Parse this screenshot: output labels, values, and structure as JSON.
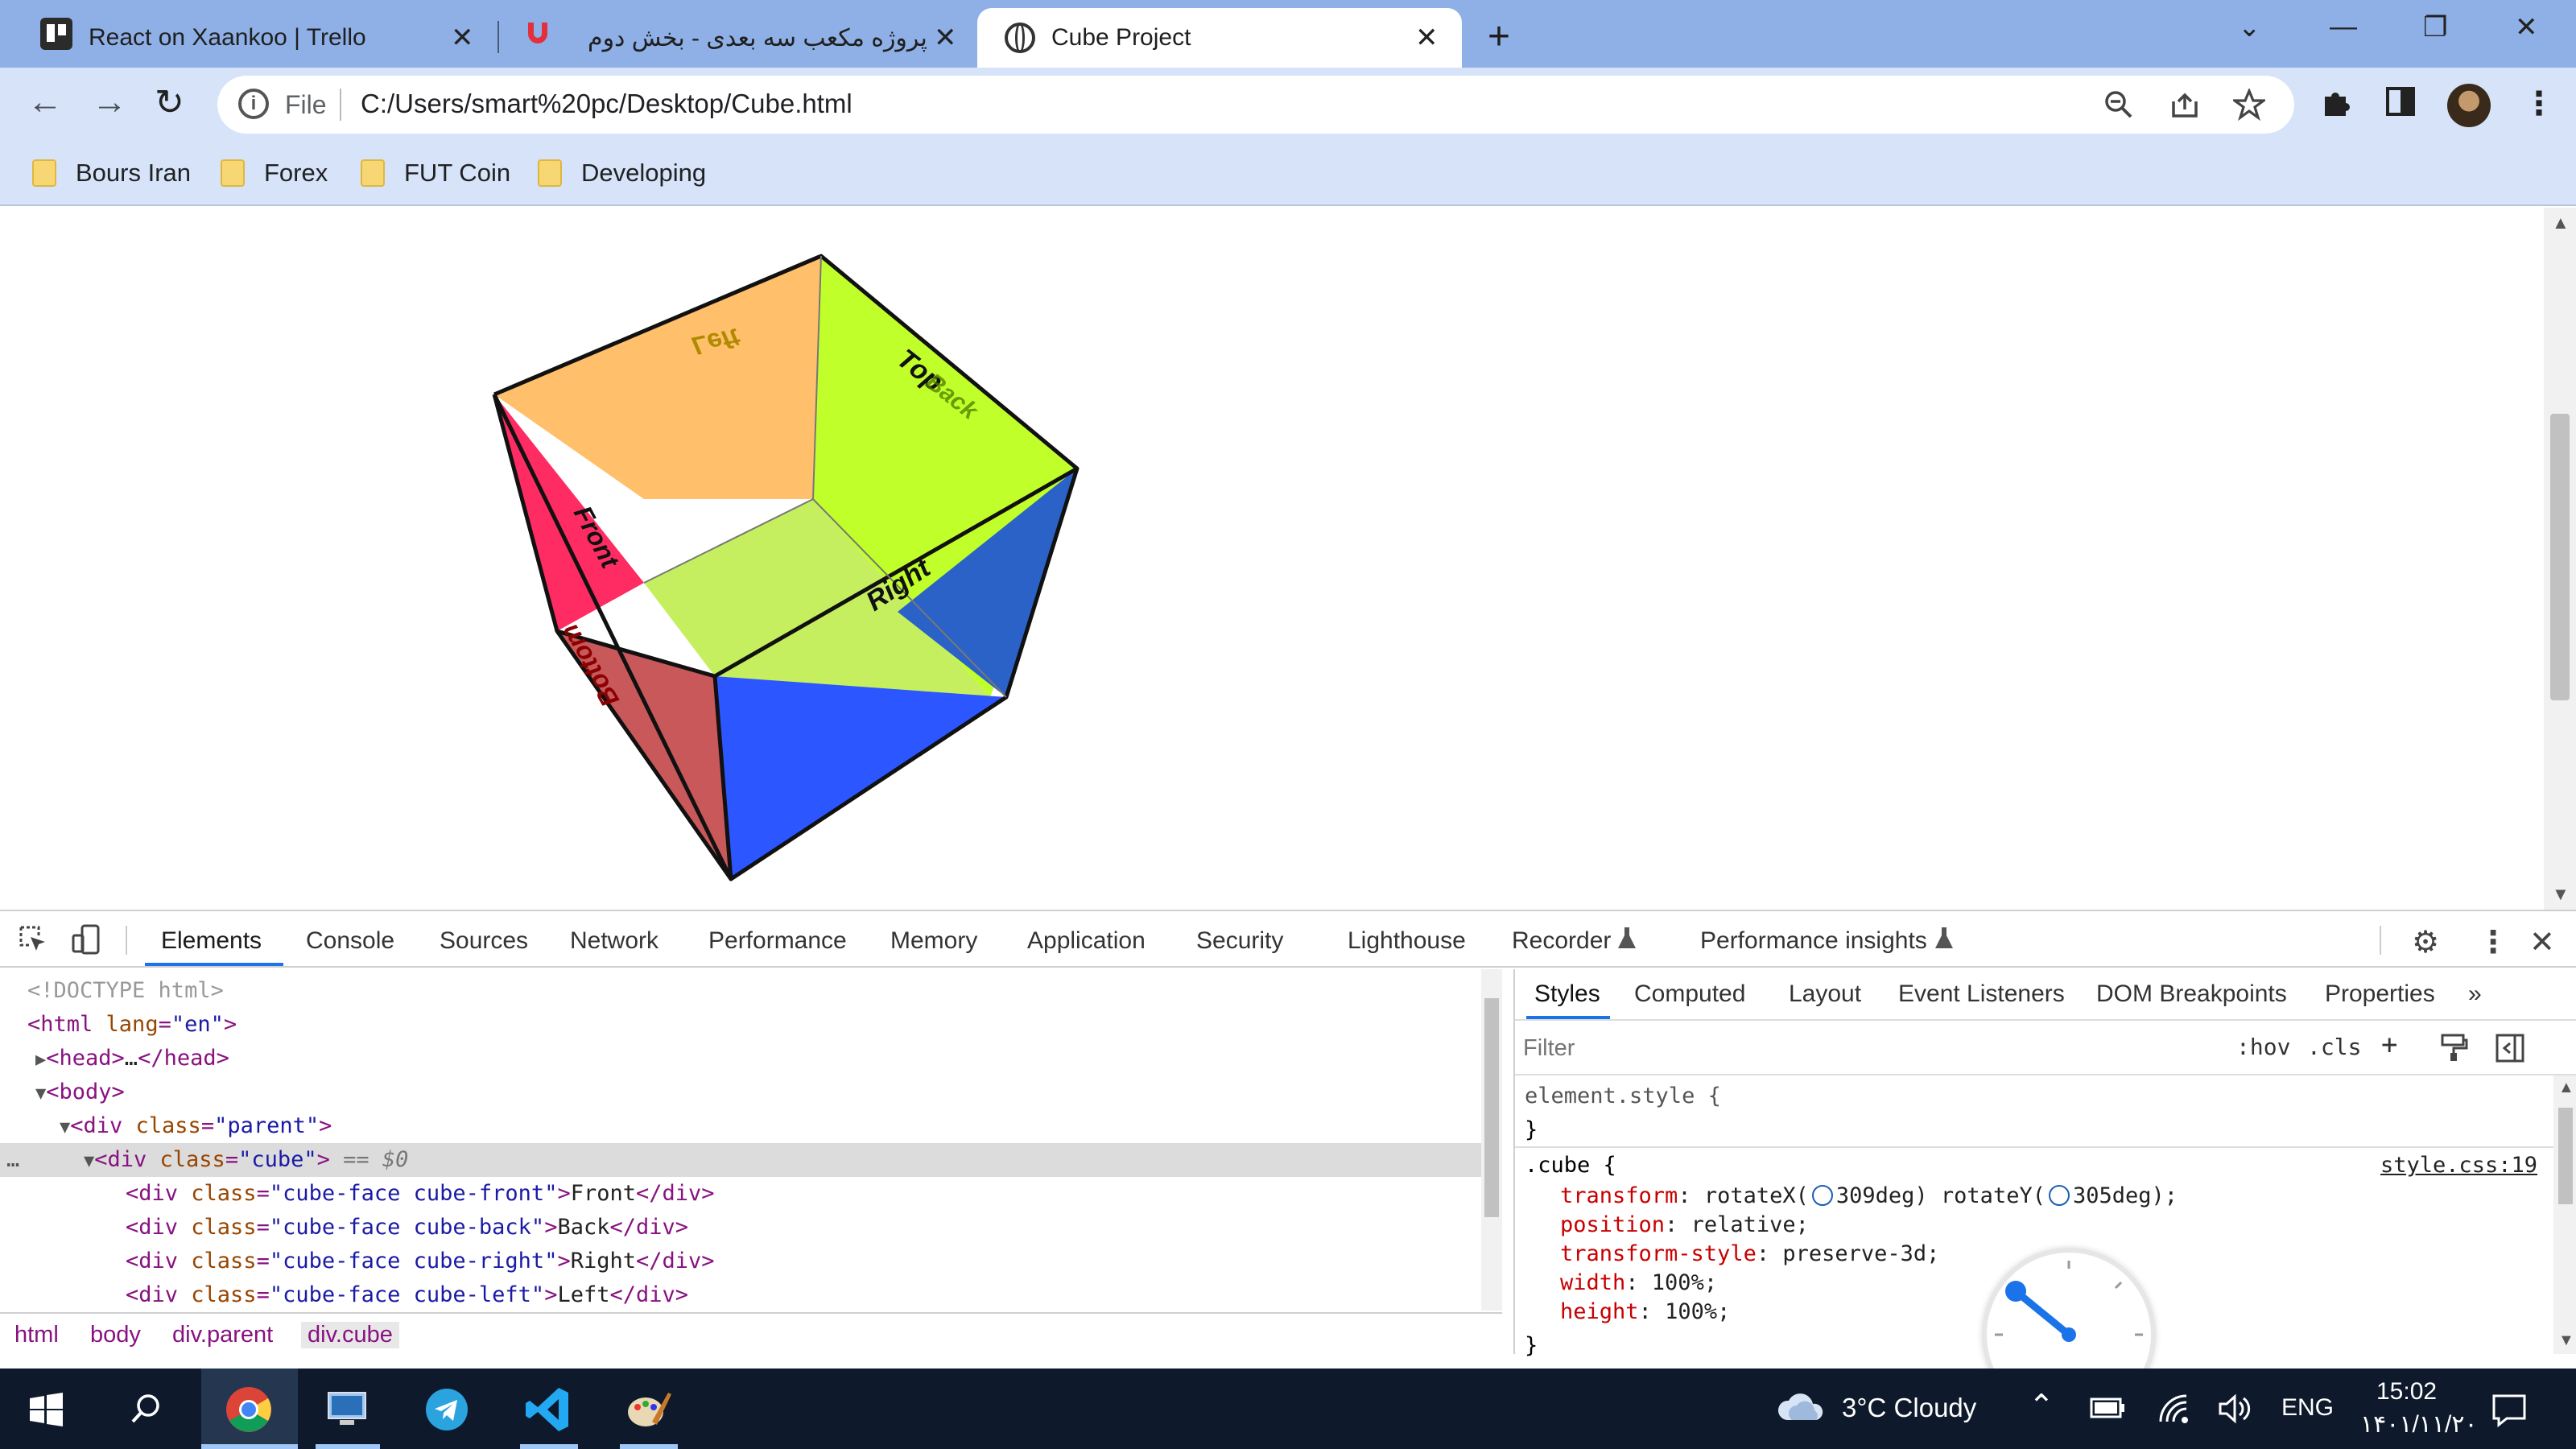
{
  "browser": {
    "tabs": [
      {
        "title": "React on Xaankoo | Trello",
        "close": "✕"
      },
      {
        "title": "پروژه مکعب سه بعدی - بخش دوم",
        "close": "✕"
      },
      {
        "title": "Cube Project",
        "close": "✕"
      }
    ],
    "new_tab": "+",
    "window_controls": {
      "tab_search": "⌄",
      "minimize": "—",
      "restore": "❐",
      "close": "✕"
    },
    "nav": {
      "back": "←",
      "forward": "→",
      "reload": "↻"
    },
    "address": {
      "scheme": "File",
      "url": "C:/Users/smart%20pc/Desktop/Cube.html"
    },
    "bookmarks": [
      "Bours Iran",
      "Forex",
      "FUT Coin",
      "Developing"
    ]
  },
  "cube": {
    "labels": {
      "left": "Left",
      "top": "Top",
      "back": "Back",
      "front": "Front",
      "right": "Right",
      "bottom": "Bottom"
    },
    "colors": {
      "back": "#ffbf6b",
      "top_inner": "#c0ff2a",
      "inner_floor": "#c5ef5e",
      "left": "#ff2c63",
      "bottom": "#c8585a",
      "right_inner": "#2a62c8",
      "front": "#2c56ff"
    }
  },
  "devtools": {
    "tabs": [
      "Elements",
      "Console",
      "Sources",
      "Network",
      "Performance",
      "Memory",
      "Application",
      "Security",
      "Lighthouse",
      "Recorder",
      "Performance insights"
    ],
    "dom": [
      {
        "text": "<!DOCTYPE html>"
      },
      {
        "tag": "<html ",
        "attr": "lang",
        "val": "\"en\"",
        "close": ">"
      },
      {
        "tag": "<head>",
        "text": "…",
        "close": "</head>"
      },
      {
        "tag": "<body>"
      },
      {
        "tag": "<div ",
        "attr": "class",
        "val": "\"parent\"",
        "close": ">"
      },
      {
        "tag": "<div ",
        "attr": "class",
        "val": "\"cube\"",
        "close": ">",
        "suffix": " == $0"
      },
      {
        "tag": "<div ",
        "attr": "class",
        "val": "\"cube-face cube-front\"",
        "close": ">",
        "text": "Front",
        "end": "</div>"
      },
      {
        "tag": "<div ",
        "attr": "class",
        "val": "\"cube-face cube-back\"",
        "close": ">",
        "text": "Back",
        "end": "</div>"
      },
      {
        "tag": "<div ",
        "attr": "class",
        "val": "\"cube-face cube-right\"",
        "close": ">",
        "text": "Right",
        "end": "</div>"
      },
      {
        "tag": "<div ",
        "attr": "class",
        "val": "\"cube-face cube-left\"",
        "close": ">",
        "text": "Left",
        "end": "</div>"
      }
    ],
    "breadcrumbs": [
      "html",
      "body",
      "div.parent",
      "div.cube"
    ],
    "styles_tabs": [
      "Styles",
      "Computed",
      "Layout",
      "Event Listeners",
      "DOM Breakpoints",
      "Properties",
      "»"
    ],
    "filter_placeholder": "Filter",
    "filter_buttons": {
      "hov": ":hov",
      "cls": ".cls",
      "add": "+"
    },
    "element_style": {
      "open": "element.style {",
      "close": "}"
    },
    "rule": {
      "selector": ".cube {",
      "source": "style.css:19",
      "transform_prop": "transform",
      "transform_a": "rotateX(",
      "transform_a_val": "309deg) rotateY(",
      "transform_b_val": "305deg);",
      "props": [
        {
          "name": "position",
          "value": "relative;"
        },
        {
          "name": "transform-style",
          "value": "preserve-3d;"
        },
        {
          "name": "width",
          "value": "100%;"
        },
        {
          "name": "height",
          "value": "100%;"
        }
      ],
      "close": "}"
    }
  },
  "taskbar": {
    "weather": "3°C  Cloudy",
    "lang": "ENG",
    "time": "15:02",
    "date": "۱۴۰۱/۱۱/۲۰"
  }
}
